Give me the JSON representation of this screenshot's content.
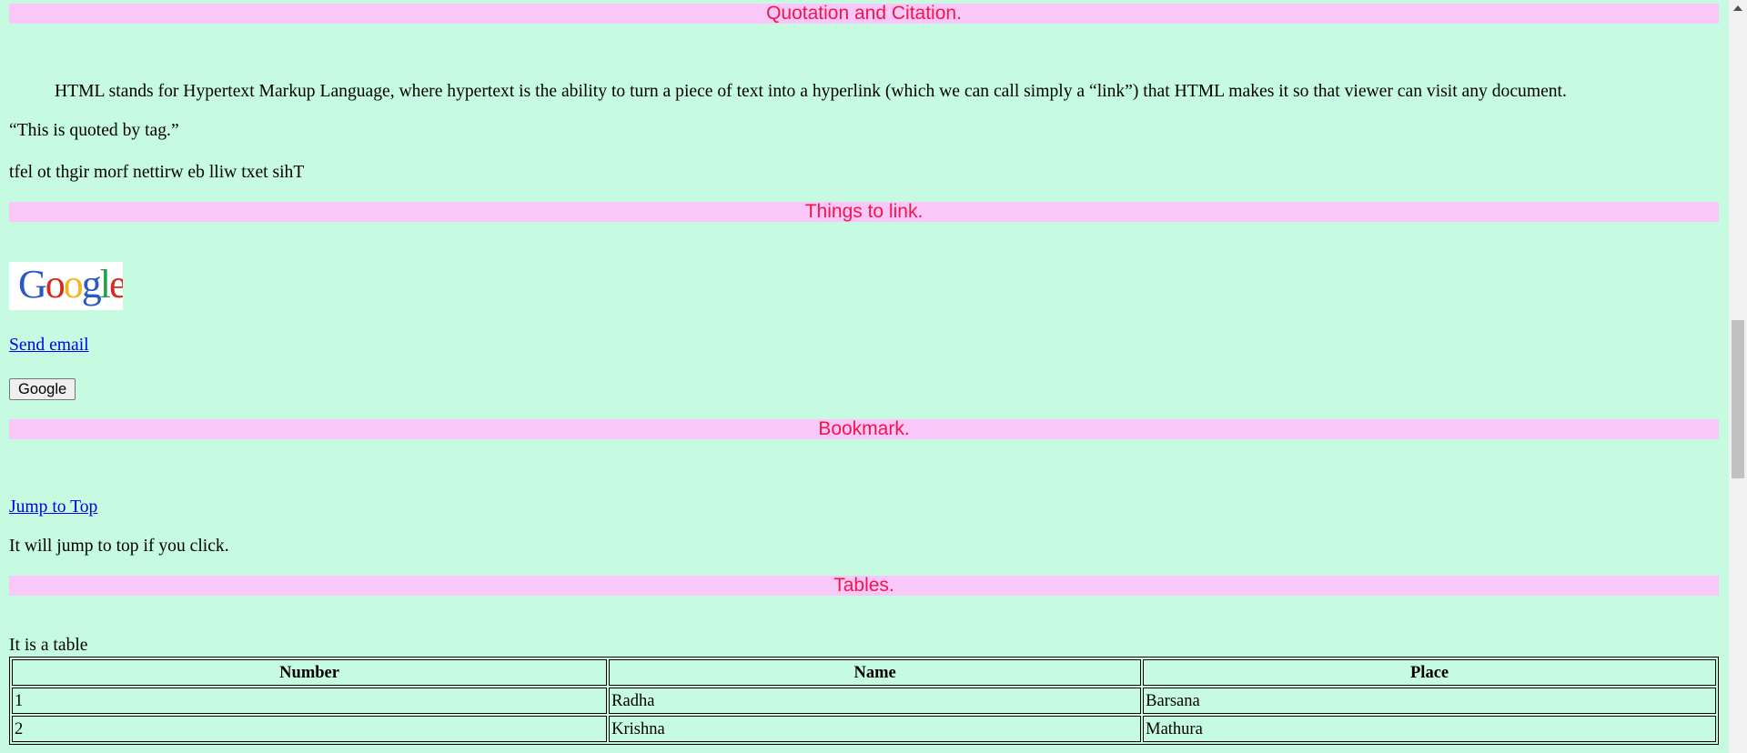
{
  "sections": {
    "quotation": {
      "heading": "Quotation and Citation.",
      "paragraph": "HTML stands for Hypertext Markup Language, where hypertext is the ability to turn a piece of text into a hyperlink (which we can call simply a “link”) that HTML makes it so that viewer can visit any document.",
      "quote": "“This is quoted by tag.”",
      "bdo": "tfel ot thgir morf nettirw eb lliw txet sihT"
    },
    "links": {
      "heading": "Things to link.",
      "logo_text": "Google",
      "send_email": "Send email",
      "google_button": "Google"
    },
    "bookmark": {
      "heading": "Bookmark.",
      "jump_link": "Jump to Top",
      "note": "It will jump to top if you click."
    },
    "tables": {
      "heading": "Tables.",
      "caption": "It is a table",
      "columns": [
        "Number",
        "Name",
        "Place"
      ],
      "rows": [
        [
          "1",
          "Radha",
          "Barsana"
        ],
        [
          "2",
          "Krishna",
          "Mathura"
        ]
      ]
    }
  },
  "colors": {
    "page_background": "#c6fbe2",
    "heading_background": "#f9c8f9",
    "heading_text": "#f5144a",
    "link": "#0000ee"
  },
  "icons": {
    "scroll_up": "triangle-up-icon",
    "logo": "google-logo"
  }
}
